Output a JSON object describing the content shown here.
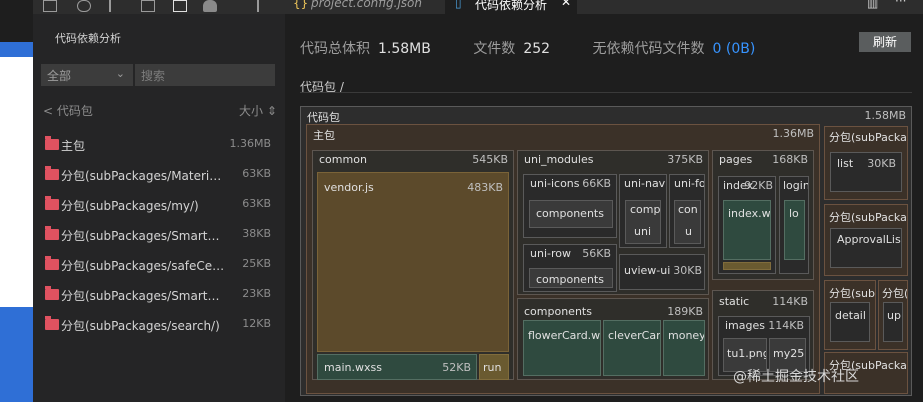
{
  "tabs": [
    {
      "label": "project.config.json",
      "icon": "json-braces-icon"
    },
    {
      "label": "代码依赖分析",
      "icon": "file-icon",
      "close": "✕"
    }
  ],
  "sidebar": {
    "title": "代码依赖分析",
    "filter_value": "全部",
    "search_placeholder": "搜索",
    "breadcrumb": "< 代码包",
    "sort_label": "大小 ⇕",
    "items": [
      {
        "name": "主包",
        "size": "1.36MB"
      },
      {
        "name": "分包(subPackages/MaterialPage/)",
        "size": "63KB"
      },
      {
        "name": "分包(subPackages/my/)",
        "size": "63KB"
      },
      {
        "name": "分包(subPackages/SmartBi/)",
        "size": "38KB"
      },
      {
        "name": "分包(subPackages/safeCenter/)",
        "size": "25KB"
      },
      {
        "name": "分包(subPackages/SmartStore/)",
        "size": "23KB"
      },
      {
        "name": "分包(subPackages/search/)",
        "size": "12KB"
      }
    ]
  },
  "stats": {
    "total_label": "代码总体积",
    "total_value": "1.58MB",
    "files_label": "文件数",
    "files_value": "252",
    "nodep_label": "无依赖代码文件数",
    "nodep_value": "0 (0B)",
    "refresh": "刷新"
  },
  "crumb": "代码包 /",
  "treemap": {
    "root": {
      "name": "代码包",
      "size": "1.58MB"
    },
    "main": {
      "name": "主包",
      "size": "1.36MB"
    },
    "common": {
      "name": "common",
      "size": "545KB"
    },
    "vendor": {
      "name": "vendor.js",
      "size": "483KB"
    },
    "mainwxss": {
      "name": "main.wxss",
      "size": "52KB"
    },
    "run": {
      "name": "run"
    },
    "uni_modules": {
      "name": "uni_modules",
      "size": "375KB"
    },
    "uni_icons": {
      "name": "uni-icons",
      "size": "66KB"
    },
    "uni_icons_comp": {
      "name": "components"
    },
    "uni_nav": {
      "name": "uni-nav"
    },
    "uni_nav_c1": {
      "name": "comp"
    },
    "uni_nav_c2": {
      "name": "uni"
    },
    "uni_fo": {
      "name": "uni-fo"
    },
    "uni_fo_c1": {
      "name": "con"
    },
    "uni_fo_c2": {
      "name": "u"
    },
    "uni_row": {
      "name": "uni-row",
      "size": "56KB"
    },
    "uni_row_comp": {
      "name": "components"
    },
    "uview": {
      "name": "uview-ui",
      "size": "30KB"
    },
    "pages": {
      "name": "pages",
      "size": "168KB"
    },
    "index": {
      "name": "index",
      "size": "92KB"
    },
    "index_wx": {
      "name": "index.wx"
    },
    "login": {
      "name": "login"
    },
    "login_c": {
      "name": "lo"
    },
    "components": {
      "name": "components",
      "size": "189KB"
    },
    "flower": {
      "name": "flowerCard.wx"
    },
    "clever": {
      "name": "cleverCard"
    },
    "money": {
      "name": "money"
    },
    "static": {
      "name": "static",
      "size": "114KB"
    },
    "images": {
      "name": "images",
      "size": "114KB"
    },
    "tu1": {
      "name": "tu1.png"
    },
    "my2": {
      "name": "my25"
    },
    "sp1": {
      "name": "分包(subPackages/MaterialPage/)"
    },
    "sp1_list": {
      "name": "list",
      "size": "30KB"
    },
    "sp2": {
      "name": "分包(subPackages/my/)"
    },
    "sp2_c": {
      "name": "ApprovalList"
    },
    "sp3": {
      "name": "分包(subPackages/SmartBi/)"
    },
    "sp3_c": {
      "name": "detail"
    },
    "sp4": {
      "name": "分包(subPackages/safeCenter/)"
    },
    "sp4_c": {
      "name": "up"
    },
    "sp5": {
      "name": "分包(subPackages/SmartStore/)"
    }
  },
  "watermark": "@稀土掘金技术社区"
}
